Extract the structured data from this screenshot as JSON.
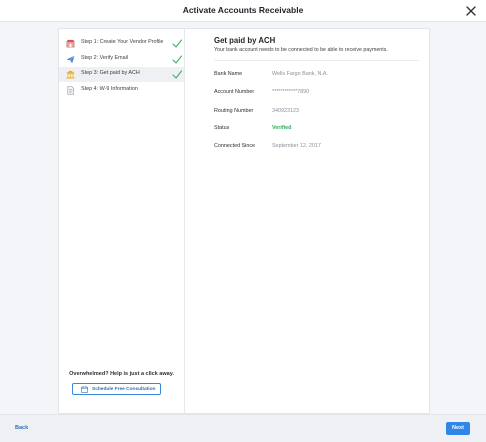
{
  "header": {
    "title": "Activate Accounts Receivable",
    "close_icon": "close-icon"
  },
  "sidebar": {
    "steps": [
      {
        "label": "Step 1: Create Your Vendor Profile",
        "icon": "store-icon",
        "completed": true,
        "active": false
      },
      {
        "label": "Step 2: Verify Email",
        "icon": "paper-plane-icon",
        "completed": true,
        "active": false
      },
      {
        "label": "Step 3: Get paid by ACH",
        "icon": "bank-icon",
        "completed": true,
        "active": true
      },
      {
        "label": "Step 4: W-9 Information",
        "icon": "document-icon",
        "completed": false,
        "active": false
      }
    ],
    "help_text": "Overwhelmed? Help is just a click away.",
    "consult_button": "Schedule Free Consultation"
  },
  "content": {
    "title": "Get paid by ACH",
    "subtitle": "Your bank account needs to be connected to be able to receive payments.",
    "rows": [
      {
        "label": "Bank Name",
        "value": "Wells Fargo Bank, N.A."
      },
      {
        "label": "Account Number",
        "value": "************7890"
      },
      {
        "label": "Routing Number",
        "value": "340923123"
      },
      {
        "label": "Status",
        "value": "Verified"
      },
      {
        "label": "Connected Since",
        "value": "September 12, 2017"
      }
    ]
  },
  "footer": {
    "back_label": "Back",
    "next_label": "Next"
  },
  "colors": {
    "accent": "#2f86e6",
    "success": "#2cae5b",
    "check": "#3fb36b"
  }
}
